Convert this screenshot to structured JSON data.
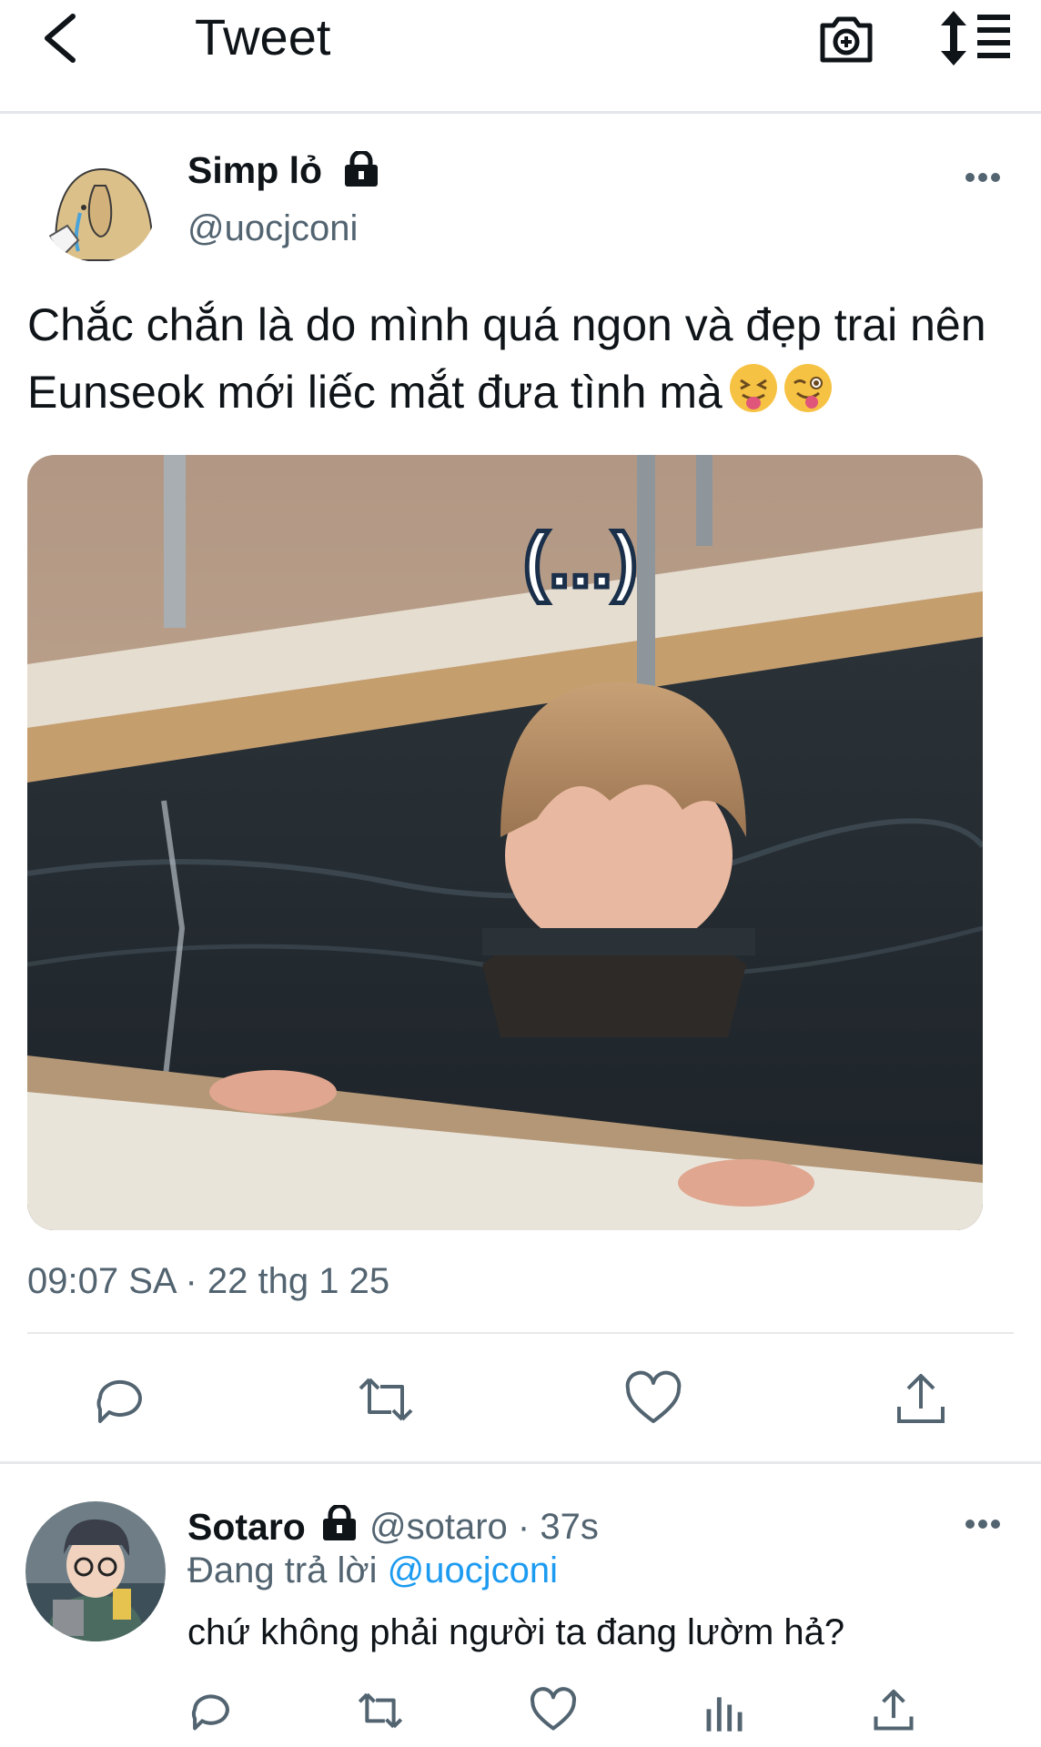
{
  "header": {
    "title": "Tweet",
    "icons": [
      "back-arrow-icon",
      "camera-icon",
      "sort-icon"
    ]
  },
  "tweet": {
    "author_name": "Simp lỏ",
    "author_handle": "@uocjconi",
    "text": "Chắc chắn là do mình quá ngon và đẹp trai nên Eunseok mới liếc mắt đưa tình mà",
    "emojis": [
      "squinting-tongue-emoji",
      "winking-tongue-emoji"
    ],
    "image_overlay_text": "(...)",
    "timestamp": "09:07 SA · 22 thg 1 25",
    "actions": [
      "reply-icon",
      "retweet-icon",
      "like-icon",
      "share-icon"
    ]
  },
  "reply": {
    "author_name": "Sotaro",
    "meta": "@sotaro · 37s",
    "replying_prefix": "Đang trả lời",
    "replying_to": "@uocjconi",
    "text": "chứ không phải người ta đang lườm hả?",
    "actions": [
      "reply-icon",
      "retweet-icon",
      "like-icon",
      "views-icon",
      "share-icon"
    ]
  },
  "colors": {
    "primary_text": "#0f1419",
    "secondary_text": "#536471",
    "accent": "#1d9bf0",
    "divider": "#e6e8eb"
  }
}
